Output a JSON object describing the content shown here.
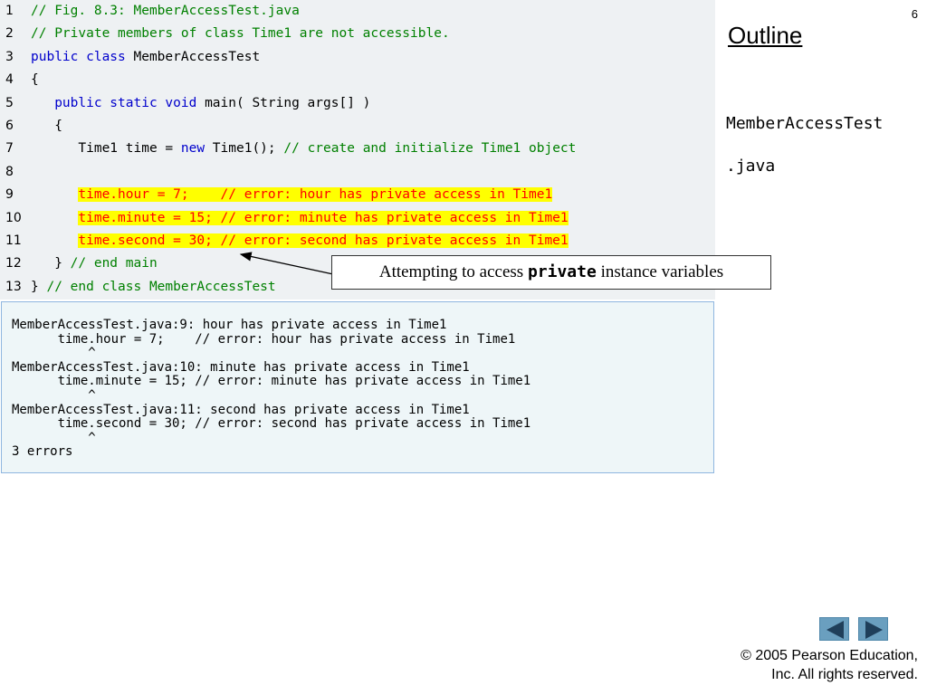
{
  "slide": {
    "page_number": "6",
    "outline_title": "Outline",
    "file_label_line1": "MemberAccessTest",
    "file_label_line2": ".java",
    "copyright_line1": "© 2005 Pearson Education,",
    "copyright_line2": "Inc.  All rights reserved."
  },
  "code_lines": [
    {
      "n": "1",
      "parts": [
        {
          "t": "// Fig. 8.3: MemberAccessTest.java",
          "c": "cm"
        }
      ]
    },
    {
      "n": "2",
      "parts": [
        {
          "t": "// Private members of class Time1 are not accessible.",
          "c": "cm"
        }
      ]
    },
    {
      "n": "3",
      "parts": [
        {
          "t": "public class",
          "c": "kw"
        },
        {
          "t": " MemberAccessTest",
          "c": ""
        }
      ]
    },
    {
      "n": "4",
      "parts": [
        {
          "t": "{",
          "c": ""
        }
      ]
    },
    {
      "n": "5",
      "parts": [
        {
          "t": "   ",
          "c": ""
        },
        {
          "t": "public static void",
          "c": "kw"
        },
        {
          "t": " main( String args[] )",
          "c": ""
        }
      ]
    },
    {
      "n": "6",
      "parts": [
        {
          "t": "   {",
          "c": ""
        }
      ]
    },
    {
      "n": "7",
      "parts": [
        {
          "t": "      Time1 time = ",
          "c": ""
        },
        {
          "t": "new",
          "c": "kw"
        },
        {
          "t": " Time1(); ",
          "c": ""
        },
        {
          "t": "// create and initialize Time1 object",
          "c": "cm"
        }
      ]
    },
    {
      "n": "8",
      "parts": []
    },
    {
      "n": "9",
      "parts": [
        {
          "t": "      ",
          "c": ""
        },
        {
          "t": "time.hour = 7;    // error: hour has private access in Time1",
          "c": "hl"
        }
      ]
    },
    {
      "n": "10",
      "parts": [
        {
          "t": "      ",
          "c": ""
        },
        {
          "t": "time.minute = 15; // error: minute has private access in Time1",
          "c": "hl"
        }
      ]
    },
    {
      "n": "11",
      "parts": [
        {
          "t": "      ",
          "c": ""
        },
        {
          "t": "time.second = 30; // error: second has private access in Time1",
          "c": "hl"
        }
      ]
    },
    {
      "n": "12",
      "parts": [
        {
          "t": "   } ",
          "c": ""
        },
        {
          "t": "// end main",
          "c": "cm"
        }
      ]
    },
    {
      "n": "13",
      "parts": [
        {
          "t": "} ",
          "c": ""
        },
        {
          "t": "// end class MemberAccessTest",
          "c": "cm"
        }
      ]
    }
  ],
  "callout": {
    "text_before": "Attempting to access ",
    "text_code": "private",
    "text_after": " instance variables"
  },
  "output_text": "MemberAccessTest.java:9: hour has private access in Time1\n      time.hour = 7;    // error: hour has private access in Time1\n          ^\nMemberAccessTest.java:10: minute has private access in Time1\n      time.minute = 15; // error: minute has private access in Time1\n          ^\nMemberAccessTest.java:11: second has private access in Time1\n      time.second = 30; // error: second has private access in Time1\n          ^\n3 errors",
  "nav": {
    "prev_icon": "triangle-left-icon",
    "next_icon": "triangle-right-icon",
    "color": "#6a9fbf"
  },
  "colors": {
    "keyword": "#0000cc",
    "comment": "#008000",
    "highlight_bg": "#ffff00",
    "highlight_text": "#ff0000"
  }
}
